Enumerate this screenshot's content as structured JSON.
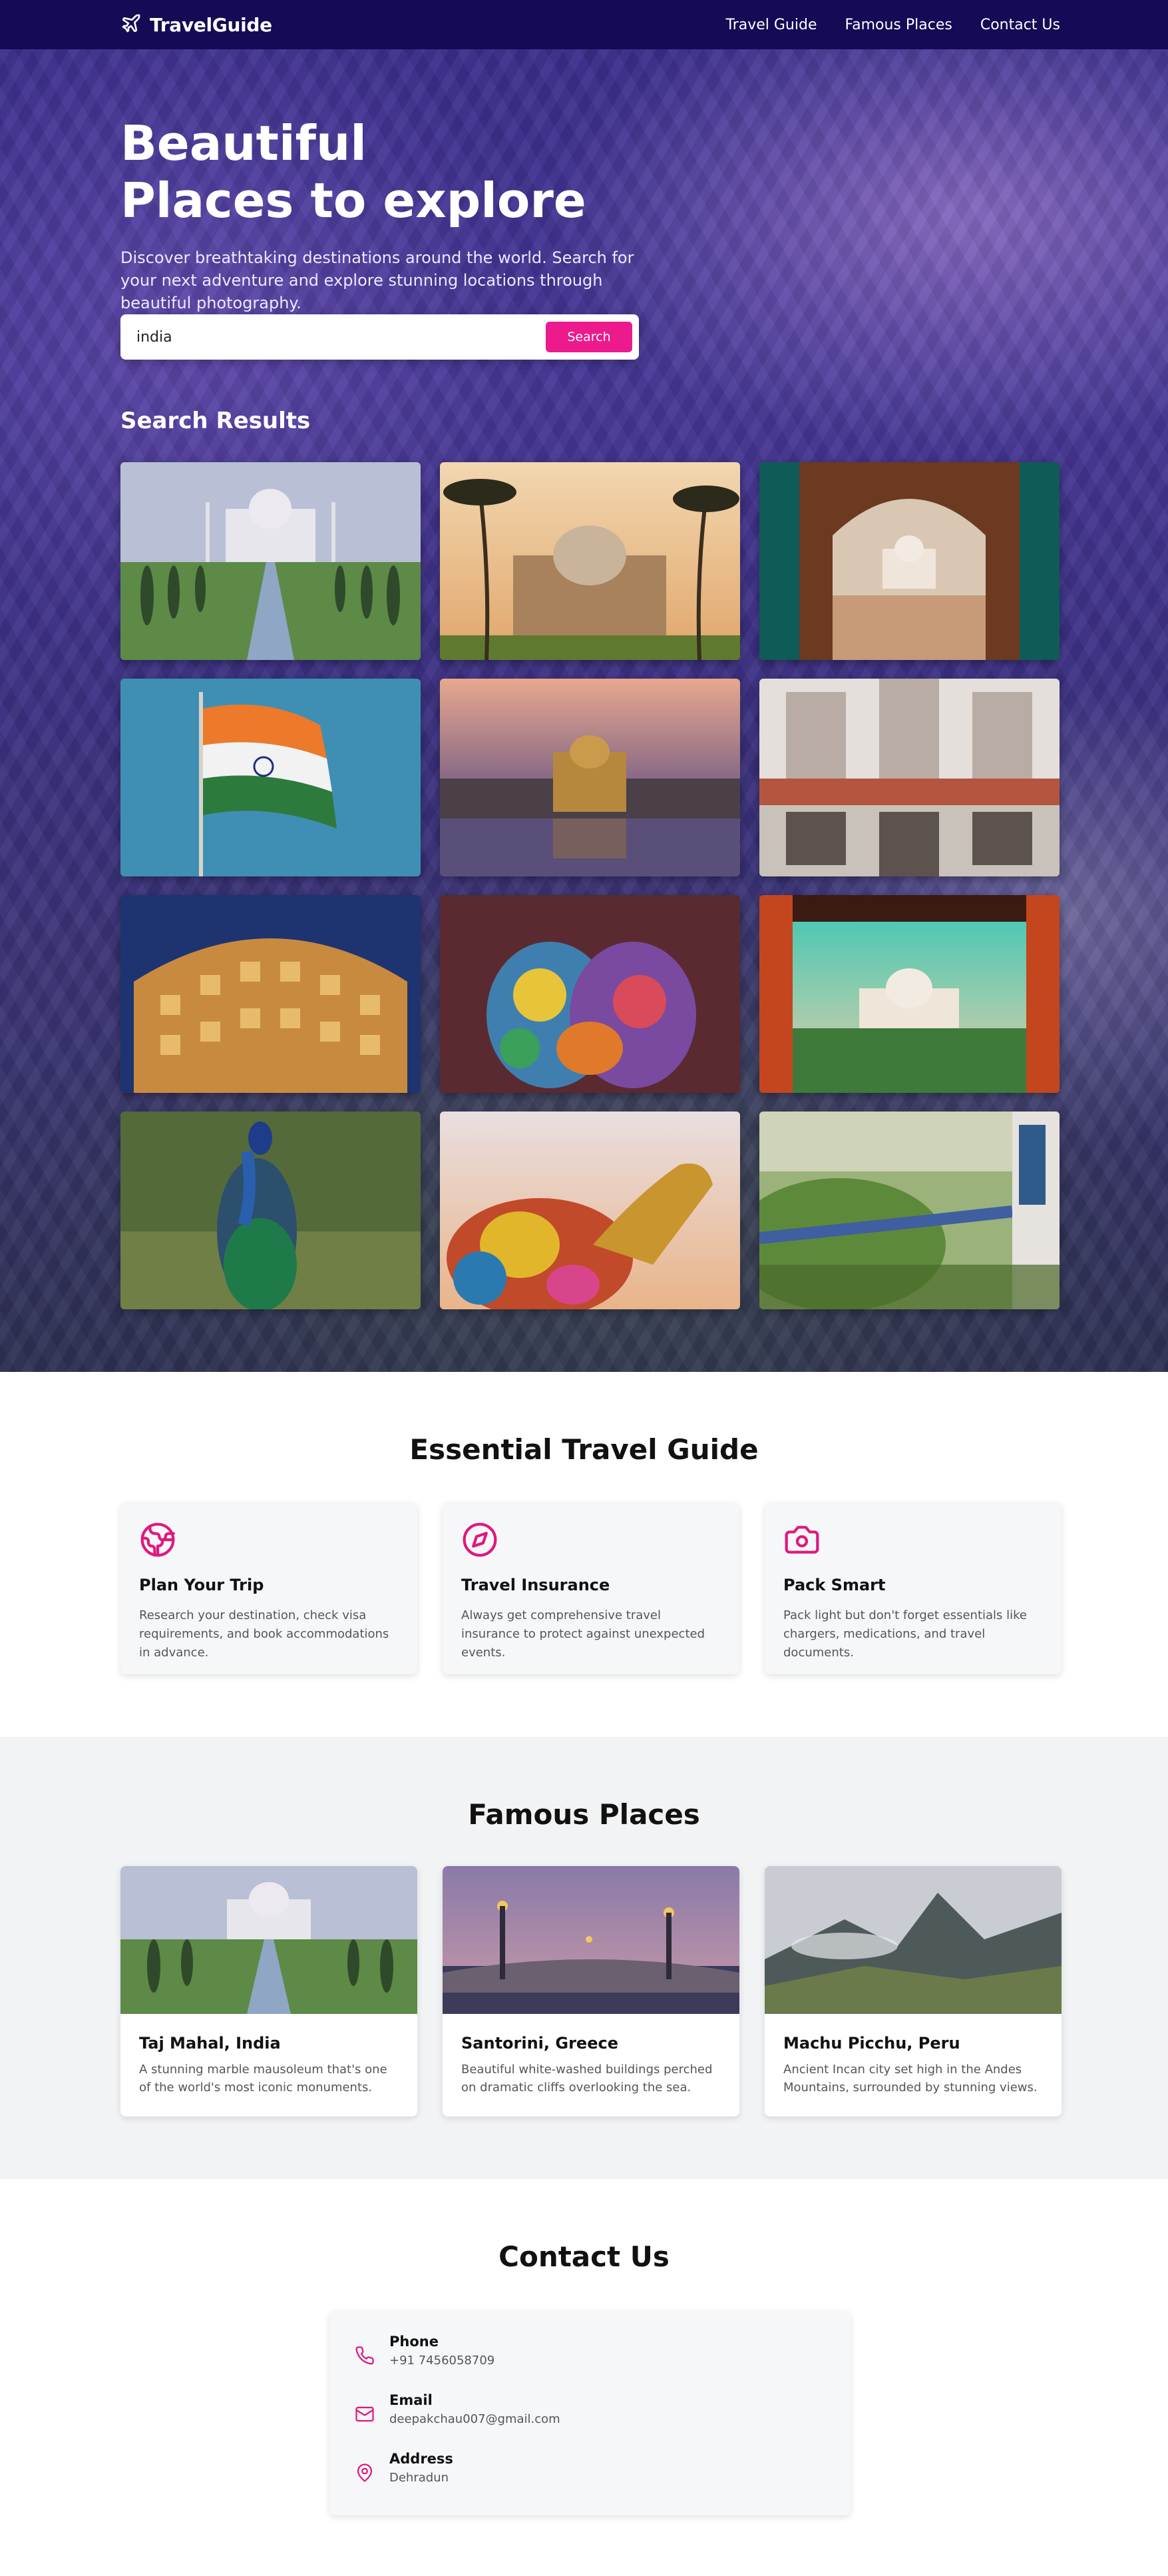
{
  "nav": {
    "brand": "TravelGuide",
    "links": [
      "Travel Guide",
      "Famous Places",
      "Contact Us"
    ]
  },
  "hero": {
    "title_line1": "Beautiful",
    "title_line2": "Places to explore",
    "subtitle": "Discover breathtaking destinations around the world. Search for your next adventure and explore stunning locations through beautiful photography.",
    "search_value": "india",
    "search_button": "Search"
  },
  "results": {
    "title": "Search Results",
    "images": [
      "taj-mahal-reflection",
      "humayun-tomb-palms",
      "taj-mahal-through-arch",
      "indian-flag",
      "golden-temple-dusk",
      "taj-mahal-facade-reflection",
      "hawa-mahal-night",
      "holi-colored-hands",
      "taj-mahal-through-red-arch",
      "peacock",
      "decorated-camel-desert",
      "train-through-hills"
    ]
  },
  "guide": {
    "title": "Essential Travel Guide",
    "cards": [
      {
        "icon": "globe-icon",
        "title": "Plan Your Trip",
        "text": "Research your destination, check visa requirements, and book accommodations in advance."
      },
      {
        "icon": "compass-icon",
        "title": "Travel Insurance",
        "text": "Always get comprehensive travel insurance to protect against unexpected events."
      },
      {
        "icon": "camera-icon",
        "title": "Pack Smart",
        "text": "Pack light but don't forget essentials like chargers, medications, and travel documents."
      }
    ]
  },
  "famous": {
    "title": "Famous Places",
    "cards": [
      {
        "title": "Taj Mahal, India",
        "text": "A stunning marble mausoleum that's one of the world's most iconic monuments."
      },
      {
        "title": "Santorini, Greece",
        "text": "Beautiful white-washed buildings perched on dramatic cliffs overlooking the sea."
      },
      {
        "title": "Machu Picchu, Peru",
        "text": "Ancient Incan city set high in the Andes Mountains, surrounded by stunning views."
      }
    ]
  },
  "contact": {
    "title": "Contact Us",
    "items": [
      {
        "icon": "phone-icon",
        "label": "Phone",
        "value": "+91 7456058709"
      },
      {
        "icon": "mail-icon",
        "label": "Email",
        "value": "deepakchau007@gmail.com"
      },
      {
        "icon": "map-pin-icon",
        "label": "Address",
        "value": "Dehradun"
      }
    ]
  },
  "colors": {
    "nav": "#140a55",
    "accent": "#ec1a8c",
    "hero_overlay": "#3a2e8c"
  }
}
